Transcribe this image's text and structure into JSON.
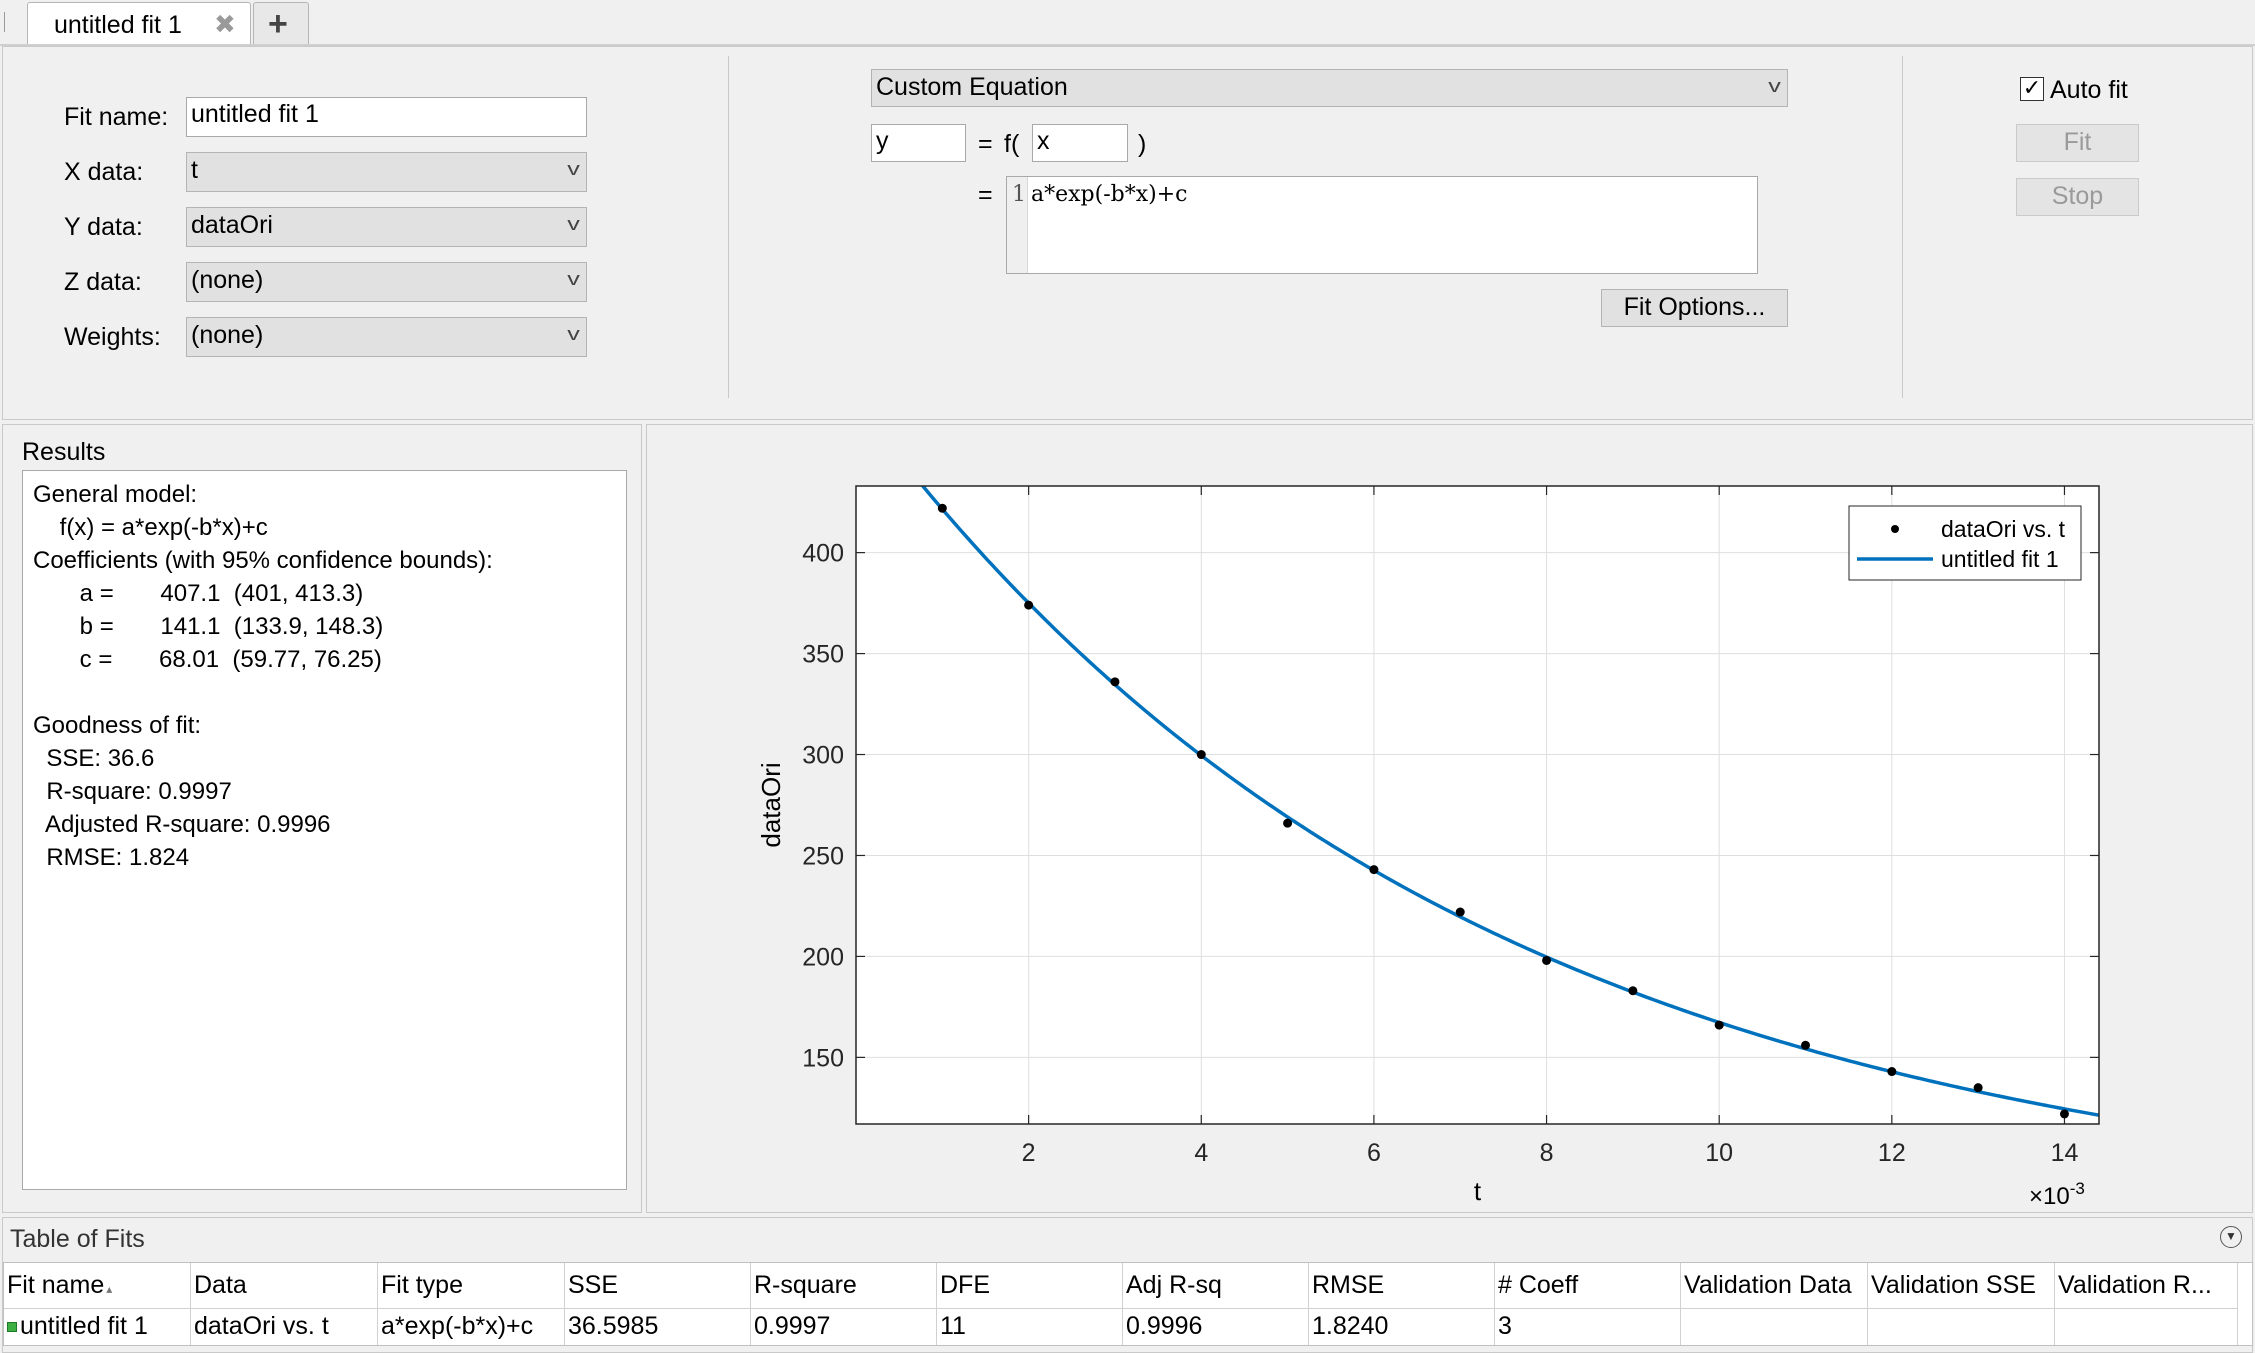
{
  "tabs": [
    {
      "label": "untitled fit 1"
    }
  ],
  "add_tab_label": "+",
  "close_glyph": "✖",
  "form": {
    "fit_name_label": "Fit name:",
    "fit_name_value": "untitled fit 1",
    "x_label": "X data:",
    "x_value": "t",
    "y_label": "Y data:",
    "y_value": "dataOri",
    "z_label": "Z data:",
    "z_value": "(none)",
    "weights_label": "Weights:",
    "weights_value": "(none)"
  },
  "equation": {
    "type": "Custom Equation",
    "dep_var": "y",
    "eq_sign": "=",
    "f_open": "f(",
    "indep_var": "x",
    "f_close": ")",
    "eq_sign2": "=",
    "line_no": "1",
    "expression": "a*exp(-b*x)+c",
    "fit_options_label": "Fit Options..."
  },
  "controls": {
    "auto_fit_label": "Auto fit",
    "auto_fit_checked": true,
    "fit_label": "Fit",
    "stop_label": "Stop"
  },
  "results": {
    "title": "Results",
    "lines": [
      "General model:",
      "    f(x) = a*exp(-b*x)+c",
      "Coefficients (with 95% confidence bounds):",
      "       a =       407.1  (401, 413.3)",
      "       b =       141.1  (133.9, 148.3)",
      "       c =       68.01  (59.77, 76.25)",
      "",
      "Goodness of fit:",
      "  SSE: 36.6",
      "  R-square: 0.9997",
      "  Adjusted R-square: 0.9996",
      "  RMSE: 1.824"
    ]
  },
  "chart_data": {
    "type": "scatter",
    "xlabel": "t",
    "ylabel": "dataOri",
    "x_exponent_label": "×10",
    "x_exponent_power": "-3",
    "xlim": [
      0.0,
      0.0144
    ],
    "ylim": [
      117,
      433
    ],
    "xticks": [
      0.002,
      0.004,
      0.006,
      0.008,
      0.01,
      0.012,
      0.014
    ],
    "xtick_labels": [
      "2",
      "4",
      "6",
      "8",
      "10",
      "12",
      "14"
    ],
    "yticks": [
      150,
      200,
      250,
      300,
      350,
      400
    ],
    "ytick_labels": [
      "150",
      "200",
      "250",
      "300",
      "350",
      "400"
    ],
    "grid": true,
    "legend_position": "top-right",
    "series": [
      {
        "name": "dataOri vs. t",
        "kind": "points",
        "color": "#000000",
        "x": [
          0.001,
          0.002,
          0.003,
          0.004,
          0.005,
          0.006,
          0.007,
          0.008,
          0.009,
          0.01,
          0.011,
          0.012,
          0.013,
          0.014
        ],
        "y": [
          422,
          374,
          336,
          300,
          266,
          243,
          222,
          198,
          183,
          166,
          156,
          143,
          135,
          122
        ]
      },
      {
        "name": "untitled fit 1",
        "kind": "curve",
        "color": "#0072BD",
        "model": {
          "a": 407.1,
          "b": 141.1,
          "c": 68.01
        }
      }
    ]
  },
  "table_of_fits": {
    "title": "Table of Fits",
    "sort_indicator": "▴",
    "columns": [
      "Fit name",
      "Data",
      "Fit type",
      "SSE",
      "R-square",
      "DFE",
      "Adj R-sq",
      "RMSE",
      "# Coeff",
      "Validation Data",
      "Validation SSE",
      "Validation R..."
    ],
    "rows": [
      [
        "untitled fit 1",
        "dataOri vs. t",
        "a*exp(-b*x)+c",
        "36.5985",
        "0.9997",
        "11",
        "0.9996",
        "1.8240",
        "3",
        "",
        "",
        ""
      ]
    ]
  }
}
